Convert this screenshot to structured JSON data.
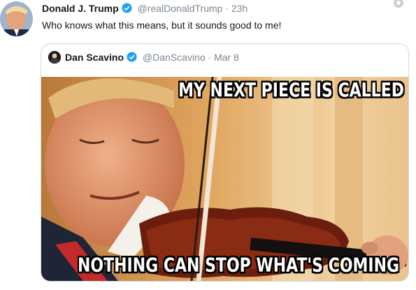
{
  "tweet": {
    "author_name": "Donald J. Trump",
    "handle": "@realDonaldTrump",
    "separator": "·",
    "time": "23h",
    "text": "Who knows what this means, but it sounds good to me!"
  },
  "quoted_tweet": {
    "author_name": "Dan Scavino",
    "handle": "@DanScavino",
    "separator": "·",
    "date": "Mar 8",
    "image_caption_top": "MY NEXT PIECE IS CALLED",
    "image_caption_bottom": "NOTHING CAN STOP WHAT'S COMING"
  },
  "colors": {
    "verified_badge": "#1da1f2",
    "muted_text": "#7a8691",
    "card_border": "#cfd9de"
  },
  "icons": {
    "verified": "verified-badge-icon",
    "top_right": "circle-icon"
  }
}
